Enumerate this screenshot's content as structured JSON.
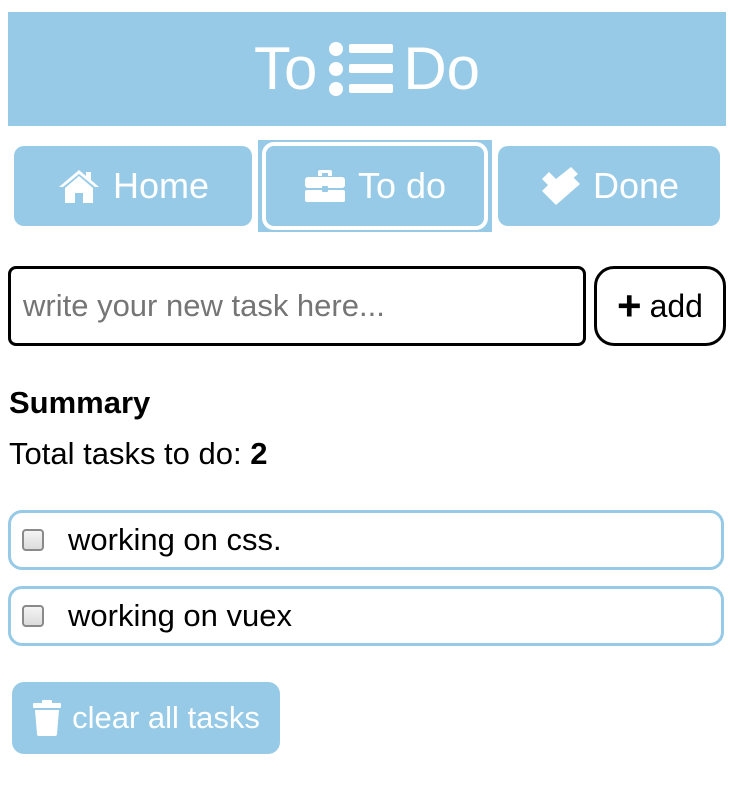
{
  "header": {
    "title_left": "To",
    "title_right": "Do",
    "logo_icon": "list-icon"
  },
  "nav": {
    "home": {
      "label": "Home",
      "icon": "home-icon"
    },
    "todo": {
      "label": "To do",
      "icon": "briefcase-icon",
      "active": true
    },
    "done": {
      "label": "Done",
      "icon": "double-check-icon"
    }
  },
  "input": {
    "placeholder": "write your new task here...",
    "value": ""
  },
  "add_button": {
    "icon": "plus-icon",
    "label": "add"
  },
  "summary": {
    "title": "Summary",
    "total_label": "Total tasks to do: ",
    "total_count": "2"
  },
  "tasks": [
    {
      "text": "working on css.",
      "checked": false
    },
    {
      "text": "working on vuex",
      "checked": false
    }
  ],
  "clear_button": {
    "icon": "trash-icon",
    "label": "clear all tasks"
  },
  "colors": {
    "accent": "#96cae6",
    "text": "#000000",
    "on_accent": "#ffffff"
  }
}
